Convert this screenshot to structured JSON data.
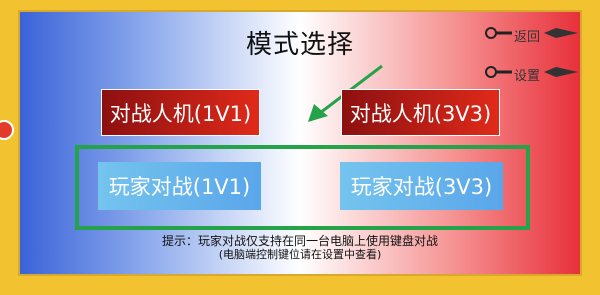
{
  "title": "模式选择",
  "nav": {
    "back_label": "返回",
    "settings_label": "设置"
  },
  "modes": {
    "ai_1v1": "对战人机(1V1)",
    "ai_3v3": "对战人机(3V3)",
    "pvp_1v1": "玩家对战(1V1)",
    "pvp_3v3": "玩家对战(3V3)"
  },
  "hint": {
    "line1": "提示：玩家对战仅支持在同一台电脑上使用键盘对战",
    "line2": "(电脑端控制键位请在设置中查看)"
  },
  "colors": {
    "frame": "#f2c230",
    "ai_button": "#c01a14",
    "pvp_button": "#66b4ec",
    "highlight": "#24a34a"
  },
  "icons": [
    "kunai-icon",
    "avatar-icon"
  ]
}
